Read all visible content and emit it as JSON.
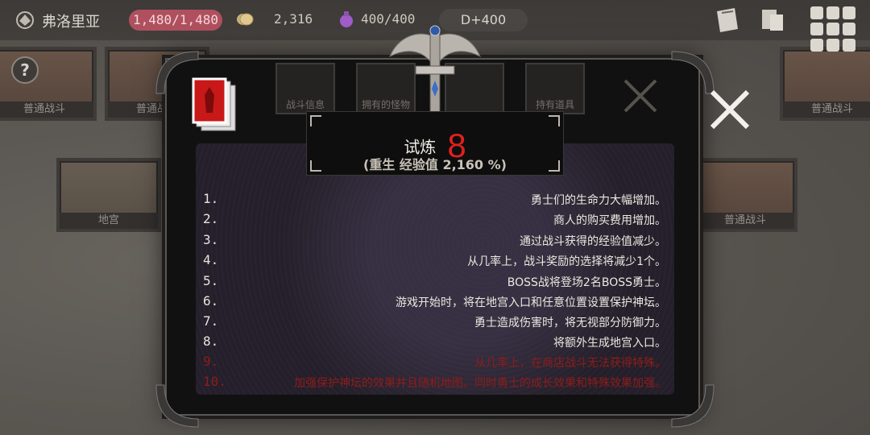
{
  "top_bar": {
    "location": "弗洛里亚",
    "hp": "1,480/1,480",
    "gold": "2,316",
    "souls": "400/400",
    "day": "D+400",
    "icons": [
      "location-sigil-icon",
      "coin-icon",
      "soul-flask-icon",
      "book-icon",
      "scroll-icon",
      "menu-grid-icon",
      "help-icon"
    ]
  },
  "background": {
    "cards": [
      "普通战斗",
      "普通战斗",
      "普通战斗",
      "地宫",
      "普通战斗"
    ]
  },
  "tabs": [
    "战斗信息",
    "拥有的怪物",
    "",
    "持有道具"
  ],
  "dialog": {
    "title_label": "试炼",
    "trial_level": "8",
    "subtitle": "(重生 经验值 2,160 %)",
    "rules": [
      {
        "idx": "1.",
        "text": "勇士们的生命力大幅增加。",
        "locked": false
      },
      {
        "idx": "2.",
        "text": "商人的购买费用增加。",
        "locked": false
      },
      {
        "idx": "3.",
        "text": "通过战斗获得的经验值减少。",
        "locked": false
      },
      {
        "idx": "4.",
        "text": "从几率上，战斗奖励的选择将减少1个。",
        "locked": false
      },
      {
        "idx": "5.",
        "text": "BOSS战将登场2名BOSS勇士。",
        "locked": false
      },
      {
        "idx": "6.",
        "text": "游戏开始时，将在地宫入口和任意位置设置保护神坛。",
        "locked": false
      },
      {
        "idx": "7.",
        "text": "勇士造成伤害时，将无视部分防御力。",
        "locked": false
      },
      {
        "idx": "8.",
        "text": "将额外生成地宫入口。",
        "locked": false
      },
      {
        "idx": "9.",
        "text": "从几率上，在商店战斗无法获得特殊。",
        "locked": true
      },
      {
        "idx": "10.",
        "text": "加强保护神坛的效果并且随机地图。同时勇士的成长效果和特殊效果加强。",
        "locked": true
      }
    ]
  },
  "colors": {
    "accent_red": "#e0201c",
    "hp_pill": "#b0505e",
    "locked_text": "#8e1d1a"
  }
}
